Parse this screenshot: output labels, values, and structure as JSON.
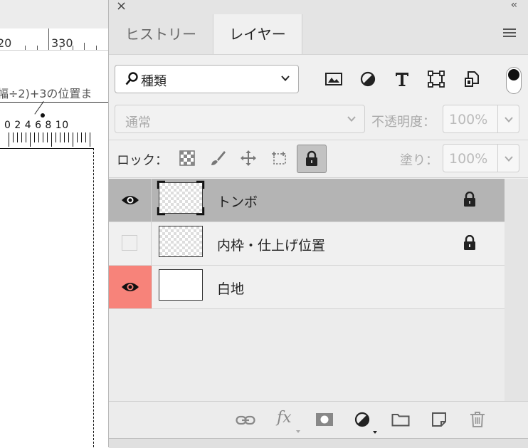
{
  "document": {
    "ruler_numbers": [
      "20",
      "330"
    ],
    "annotation": "幅÷2)+3の位置ま",
    "mini_scale": "0 2 4 6 8 10"
  },
  "panel": {
    "close_glyph": "×",
    "collapse_glyph": "‹‹",
    "tabs": [
      {
        "label": "ヒストリー",
        "active": false
      },
      {
        "label": "レイヤー",
        "active": true
      }
    ],
    "filter": {
      "selected": "種類",
      "icons": [
        "image-filter-icon",
        "adjustment-filter-icon",
        "text-filter-icon",
        "shape-filter-icon",
        "smart-object-filter-icon"
      ]
    },
    "blend": {
      "mode": "通常",
      "opacity_label": "不透明度：",
      "opacity_value": "100%"
    },
    "lock": {
      "label": "ロック：",
      "icons": [
        "lock-transparent-pixels-icon",
        "lock-image-pixels-icon",
        "lock-position-icon",
        "lock-artboard-icon",
        "lock-all-icon"
      ],
      "fill_label": "塗り：",
      "fill_value": "100%"
    },
    "layers": [
      {
        "name": "トンボ",
        "visible": true,
        "selected": true,
        "locked": true,
        "thumb": "transparent"
      },
      {
        "name": "内枠・仕上げ位置",
        "visible": false,
        "selected": false,
        "locked": true,
        "thumb": "transparent"
      },
      {
        "name": "白地",
        "visible": true,
        "selected": false,
        "locked": false,
        "thumb": "white",
        "highlight": "#f7837a"
      }
    ],
    "bottom_icons": [
      "link-layers-icon",
      "fx-icon",
      "add-mask-icon",
      "new-adjustment-layer-icon",
      "new-group-icon",
      "new-layer-icon",
      "delete-layer-icon"
    ],
    "fx_label": "fx",
    "colors": {
      "selected_row": "#b4b4b4",
      "panel_bg": "#f0f0f0",
      "eye_highlight": "#f7837a"
    }
  }
}
